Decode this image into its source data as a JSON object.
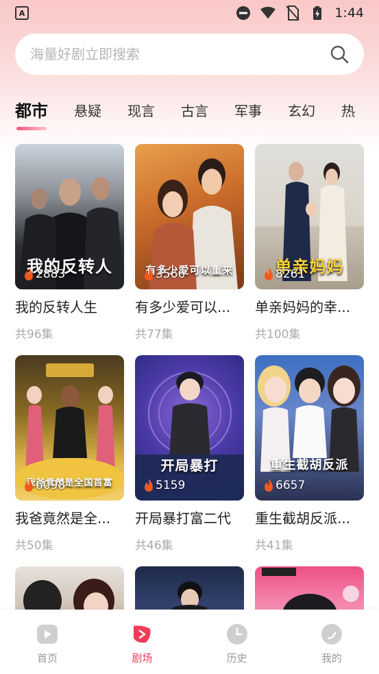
{
  "status_bar": {
    "time": "1:44"
  },
  "search": {
    "placeholder": "海量好剧立即搜索"
  },
  "tabs": [
    {
      "label": "都市"
    },
    {
      "label": "悬疑"
    },
    {
      "label": "现言"
    },
    {
      "label": "古言"
    },
    {
      "label": "军事"
    },
    {
      "label": "玄幻"
    },
    {
      "label": "热"
    }
  ],
  "dramas": [
    {
      "title": "我的反转人生",
      "episodes": "共96集",
      "views": "2883",
      "poster_text": "我的反转人"
    },
    {
      "title": "有多少爱可以...",
      "episodes": "共77集",
      "views": "3566",
      "poster_text": "有多少爱可以重来"
    },
    {
      "title": "单亲妈妈的幸...",
      "episodes": "共100集",
      "views": "8261",
      "poster_text": "单亲妈妈"
    },
    {
      "title": "我爸竟然是全...",
      "episodes": "共50集",
      "views": "6098",
      "poster_text": "我爸竟然是全国首富"
    },
    {
      "title": "开局暴打富二代",
      "episodes": "共46集",
      "views": "5159",
      "poster_text": "开局暴打"
    },
    {
      "title": "重生截胡反派...",
      "episodes": "共41集",
      "views": "6657",
      "poster_text": "重生截胡反派"
    }
  ],
  "bottom_nav": [
    {
      "label": "首页"
    },
    {
      "label": "剧场"
    },
    {
      "label": "历史"
    },
    {
      "label": "我的"
    }
  ],
  "colors": {
    "accent": "#ef3d5a",
    "tab_underline": "#f5557a"
  }
}
